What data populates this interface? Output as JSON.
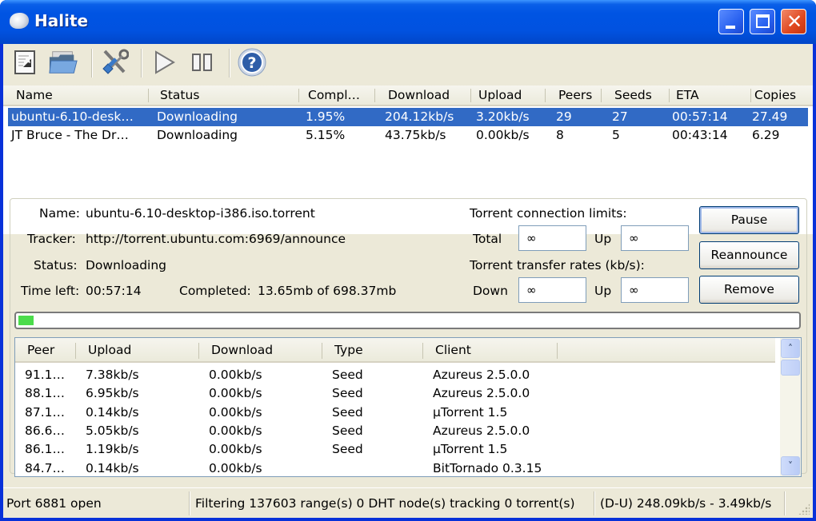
{
  "window": {
    "title": "Halite",
    "controls": [
      "minimize",
      "maximize",
      "close"
    ],
    "close_glyph": "✕"
  },
  "toolbar": {
    "buttons": [
      {
        "name": "add-torrent",
        "icon": "document-wrench-icon"
      },
      {
        "name": "open-folder",
        "icon": "folder-open-icon"
      },
      {
        "name": "settings",
        "icon": "tools-icon"
      },
      {
        "name": "resume",
        "icon": "play-icon"
      },
      {
        "name": "pause",
        "icon": "pause-icon"
      },
      {
        "name": "help",
        "icon": "help-icon",
        "glyph": "?"
      }
    ]
  },
  "torrents": {
    "columns": [
      "Name",
      "Status",
      "Compl…",
      "Download",
      "Upload",
      "Peers",
      "Seeds",
      "ETA",
      "Copies"
    ],
    "rows": [
      {
        "name": "ubuntu-6.10-desk…",
        "status": "Downloading",
        "completed": "1.95%",
        "download": "204.12kb/s",
        "upload": "3.20kb/s",
        "peers": "29",
        "seeds": "27",
        "eta": "00:57:14",
        "copies": "27.49",
        "selected": true
      },
      {
        "name": "JT Bruce - The Dr…",
        "status": "Downloading",
        "completed": "5.15%",
        "download": "43.75kb/s",
        "upload": "0.00kb/s",
        "peers": "8",
        "seeds": "5",
        "eta": "00:43:14",
        "copies": "6.29",
        "selected": false
      }
    ]
  },
  "details": {
    "name_label": "Name:",
    "name_value": "ubuntu-6.10-desktop-i386.iso.torrent",
    "tracker_label": "Tracker:",
    "tracker_value": "http://torrent.ubuntu.com:6969/announce",
    "status_label": "Status:",
    "status_value": "Downloading",
    "time_left_label": "Time left:",
    "time_left_value": "00:57:14",
    "completed_label": "Completed:",
    "completed_value": "13.65mb of 698.37mb",
    "progress_percent": 1.95,
    "progress_color": "#4bdc4b",
    "connection_limits_title": "Torrent connection limits:",
    "total_label": "Total",
    "total_value": "∞",
    "conn_up_label": "Up",
    "conn_up_value": "∞",
    "transfer_rates_title": "Torrent transfer rates (kb/s):",
    "down_label": "Down",
    "down_value": "∞",
    "rate_up_label": "Up",
    "rate_up_value": "∞",
    "buttons": {
      "pause": "Pause",
      "reannounce": "Reannounce",
      "remove": "Remove"
    }
  },
  "peers": {
    "columns": [
      "Peer",
      "Upload",
      "Download",
      "Type",
      "Client"
    ],
    "rows": [
      {
        "peer": "91.1…",
        "upload": "7.38kb/s",
        "download": "0.00kb/s",
        "type": "Seed",
        "client": "Azureus 2.5.0.0"
      },
      {
        "peer": "88.1…",
        "upload": "6.95kb/s",
        "download": "0.00kb/s",
        "type": "Seed",
        "client": "Azureus 2.5.0.0"
      },
      {
        "peer": "87.1…",
        "upload": "0.14kb/s",
        "download": "0.00kb/s",
        "type": "Seed",
        "client": "µTorrent 1.5"
      },
      {
        "peer": "86.6…",
        "upload": "5.05kb/s",
        "download": "0.00kb/s",
        "type": "Seed",
        "client": "Azureus 2.5.0.0"
      },
      {
        "peer": "86.1…",
        "upload": "1.19kb/s",
        "download": "0.00kb/s",
        "type": "Seed",
        "client": "µTorrent 1.5"
      },
      {
        "peer": "84.7…",
        "upload": "0.14kb/s",
        "download": "0.00kb/s",
        "type": "",
        "client": "BitTornado 0.3.15"
      }
    ],
    "scroll_up_glyph": "˄",
    "scroll_down_glyph": "˅"
  },
  "statusbar": {
    "port": "Port 6881 open",
    "filter_dht": "Filtering 137603 range(s) 0 DHT node(s) tracking 0 torrent(s)",
    "rates": "(D-U) 248.09kb/s - 3.49kb/s"
  },
  "colors": {
    "selection": "#316ac5",
    "titlebar": "#0054e3",
    "face": "#ece9d8"
  }
}
